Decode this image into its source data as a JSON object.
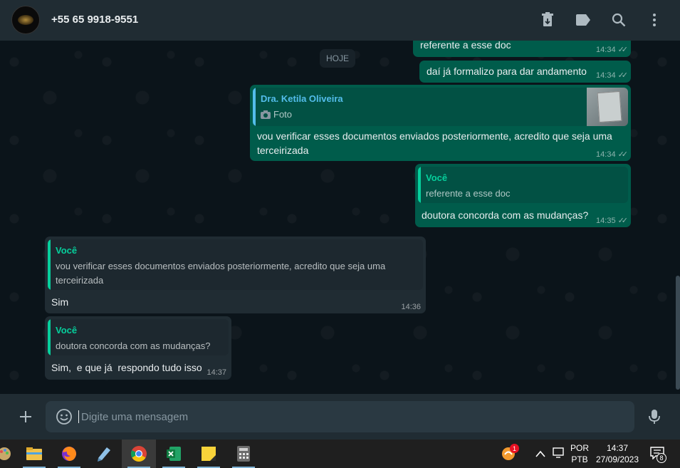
{
  "header": {
    "contact_name": "+55 65 9918-9551",
    "icons": [
      "archive-icon",
      "label-icon",
      "search-icon",
      "more-vertical-icon"
    ]
  },
  "chat": {
    "date_chip": "HOJE",
    "messages": [
      {
        "dir": "out",
        "text": "referente a esse doc",
        "time": "14:34"
      },
      {
        "dir": "out",
        "text": "daí já formalizo para dar andamento",
        "time": "14:34"
      },
      {
        "dir": "out",
        "quote_author": "Dra. Ketila Oliveira",
        "quote_text": "Foto",
        "text": "vou verificar esses documentos enviados posteriormente, acredito que seja uma terceirizada",
        "time": "14:34"
      },
      {
        "dir": "out",
        "quote_author": "Você",
        "quote_text": "referente a esse doc",
        "text": "doutora concorda com as mudanças?",
        "time": "14:35"
      },
      {
        "dir": "in",
        "quote_author": "Você",
        "quote_text": "vou verificar esses documentos enviados posteriormente, acredito que seja uma terceirizada",
        "text": "Sim",
        "time": "14:36"
      },
      {
        "dir": "in",
        "quote_author": "Você",
        "quote_text": "doutora concorda com as mudanças?",
        "text": "Sim,  e que já  respondo tudo isso",
        "time": "14:37"
      }
    ]
  },
  "composer": {
    "placeholder": "Digite uma mensagem"
  },
  "taskbar": {
    "apps": [
      "paint-icon",
      "file-explorer-icon",
      "firefox-icon",
      "notepad-icon",
      "chrome-icon",
      "excel-icon",
      "sticky-notes-icon",
      "calculator-icon"
    ],
    "active_app": "chrome-icon",
    "badge_count": "1",
    "lang_line1": "POR",
    "lang_line2": "PTB",
    "clock_time": "14:37",
    "clock_date": "27/09/2023",
    "notif_count": "8"
  },
  "colors": {
    "outgoing_bubble": "#005c4b",
    "incoming_bubble": "#202c33",
    "header": "#202c33",
    "background": "#0b141a",
    "quote_blue": "#53bdeb",
    "quote_green": "#06cf9c"
  }
}
